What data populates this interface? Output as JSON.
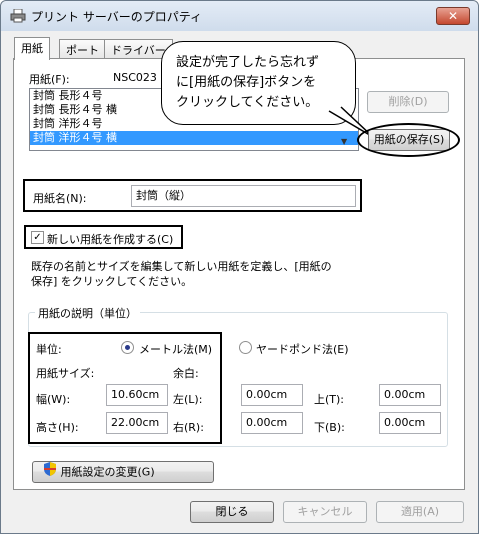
{
  "window": {
    "title": "プリント サーバーのプロパティ",
    "close": "✕"
  },
  "tabs": [
    "用紙",
    "ポート",
    "ドライバー"
  ],
  "paper": {
    "label": "用紙(F):",
    "printer": "NSC023",
    "items": [
      "封筒 長形４号",
      "封筒 長形４号 横",
      "封筒 洋形４号",
      "封筒 洋形４号 横"
    ],
    "delete_button": "削除(D)",
    "save_button": "用紙の保存(S)"
  },
  "callout": {
    "lines": [
      "設定が完了したら忘れず",
      "に[用紙の保存]ボタンを",
      "クリックしてください。"
    ]
  },
  "paper_name": {
    "label": "用紙名(N):",
    "value": "封筒（縦）"
  },
  "create_new": {
    "label": "新しい用紙を作成する(C)",
    "checked": "✓"
  },
  "description": "既存の名前とサイズを編集して新しい用紙を定義し、[用紙の保存] をクリックしてください。",
  "description_lines": [
    "既存の名前とサイズを編集して新しい用紙を定義し、[用紙の",
    "保存] をクリックしてください。"
  ],
  "group": {
    "title": "用紙の説明（単位）",
    "units_label": "単位:",
    "metric": "メートル法(M)",
    "imperial": "ヤードポンド法(E)",
    "paper_size": "用紙サイズ:",
    "margins": "余白:",
    "width_label": "幅(W):",
    "width": "10.60cm",
    "height_label": "高さ(H):",
    "height": "22.00cm",
    "left_label": "左(L):",
    "left": "0.00cm",
    "right_label": "右(R):",
    "right": "0.00cm",
    "top_label": "上(T):",
    "top": "0.00cm",
    "bottom_label": "下(B):",
    "bottom": "0.00cm"
  },
  "change_settings_button": "用紙設定の変更(G)",
  "footer": {
    "close": "閉じる",
    "cancel": "キャンセル",
    "apply": "適用(A)"
  }
}
